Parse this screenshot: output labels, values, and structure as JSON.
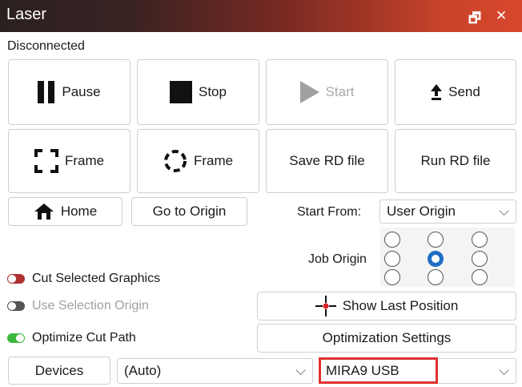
{
  "window": {
    "title": "Laser",
    "restore_icon": "restore-icon",
    "close_icon": "close-icon"
  },
  "status": "Disconnected",
  "buttons": {
    "pause": "Pause",
    "stop": "Stop",
    "start": "Start",
    "send": "Send",
    "frame1": "Frame",
    "frame2": "Frame",
    "save_rd": "Save RD file",
    "run_rd": "Run RD file",
    "home": "Home",
    "go_origin": "Go to Origin",
    "show_last": "Show Last Position",
    "opt_settings": "Optimization Settings",
    "devices": "Devices"
  },
  "start_from": {
    "label": "Start From:",
    "value": "User Origin"
  },
  "job_origin": {
    "label": "Job Origin",
    "selected": "top-center"
  },
  "toggles": [
    {
      "label": "Cut Selected Graphics",
      "state": "off",
      "color": "#b03030"
    },
    {
      "label": "Use Selection Origin",
      "state": "off",
      "color": "#555555",
      "disabled": true
    },
    {
      "label": "Optimize Cut Path",
      "state": "on",
      "color": "#3cb83c"
    }
  ],
  "device_mode": {
    "value": "(Auto)"
  },
  "device_port": {
    "value": "MIRA9 USB"
  }
}
